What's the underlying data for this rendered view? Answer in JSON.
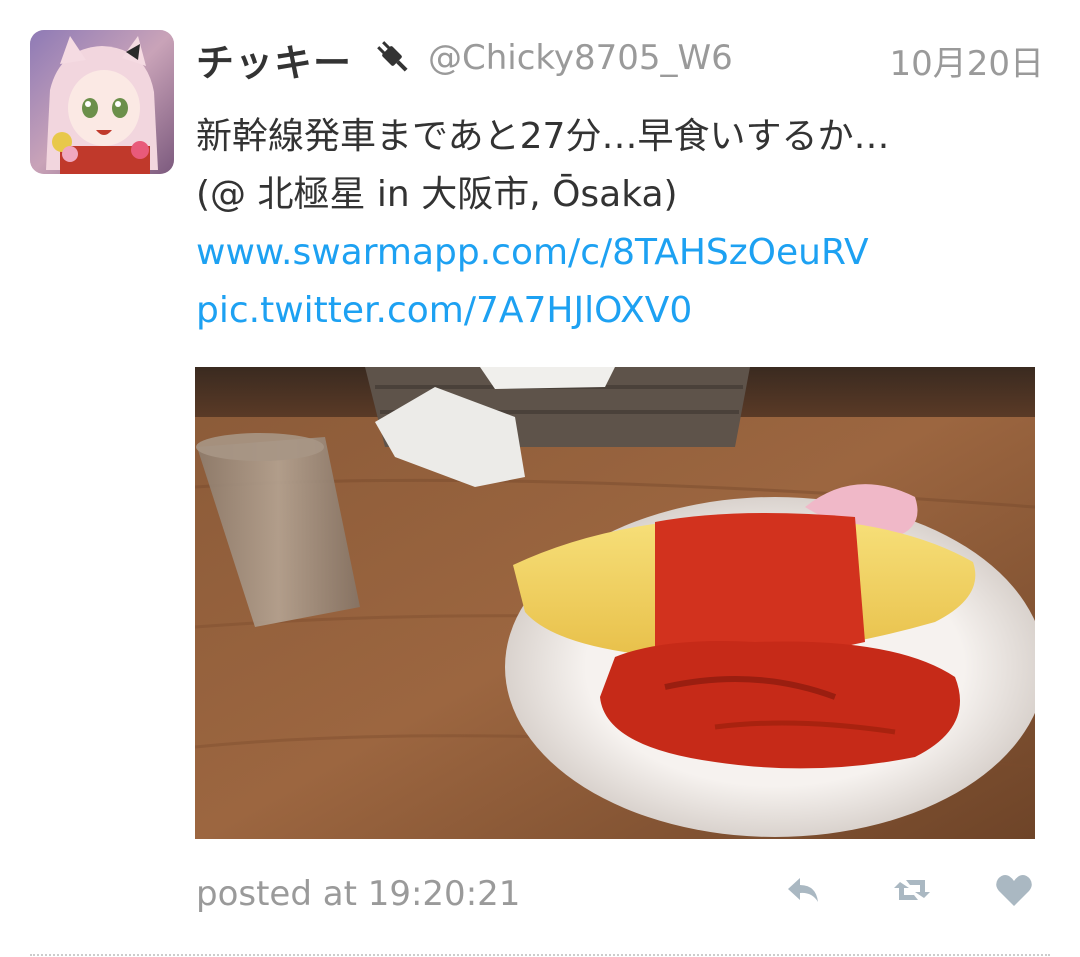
{
  "tweet": {
    "user": {
      "display_name": "チッキー",
      "name_icon": "plug-icon",
      "handle": "@Chicky8705_W6",
      "avatar": "anime-character-avatar"
    },
    "date": "10月20日",
    "text_lines": [
      "新幹線発車まであと27分…早食いするか…",
      "(@ 北極星 in 大阪市, Ōsaka)"
    ],
    "links": [
      "www.swarmapp.com/c/8TAHSzOeuRV",
      "pic.twitter.com/7A7HJlOXV0"
    ],
    "photo": {
      "subject": "omurice-on-plate-photo"
    },
    "posted_at": "posted at 19:20:21",
    "actions": {
      "reply": "reply-icon",
      "retweet": "retweet-icon",
      "favorite": "heart-icon"
    }
  },
  "colors": {
    "text": "#333333",
    "muted": "#9a9a9a",
    "link": "#1da1f2",
    "icon": "#aab8c2"
  }
}
